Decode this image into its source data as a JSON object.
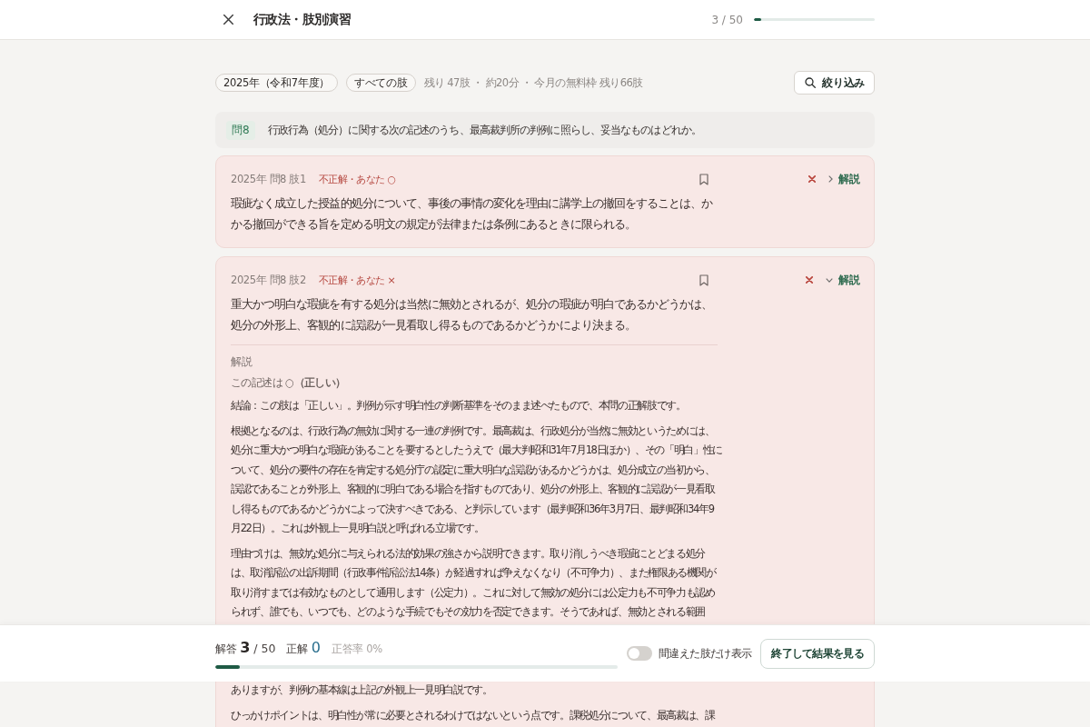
{
  "header": {
    "title": "行政法・肢別演習",
    "progress_text": "3 / 50",
    "level": 0.06
  },
  "filters": {
    "chips": [
      {
        "label": "2025年（令和7年度）"
      },
      {
        "label": "すべての肢"
      }
    ],
    "summary": "残り 47肢 ・ 約20分 ・ 今月の無料枠 残り66肢",
    "button": "絞り込み"
  },
  "question": {
    "number": "問8",
    "text": "行政行為（処分）に関する次の記述のうち、最高裁判所の判例に照らし、妥当なものはどれか。"
  },
  "choices": [
    {
      "meta": "2025年 問8 肢1",
      "status": "不正解・あなた ○",
      "statement": "瑕疵なく成立した授益的処分について、事後の事情の変化を理由に講学上の撤回をすることは、かかる撤回ができる旨を定める明文の規定が法律または条例にあるときに限られる。",
      "bookmarked": false,
      "correct": false,
      "toggle_label": "解説",
      "expanded": false
    },
    {
      "meta": "2025年 問8 肢2",
      "status": "不正解・あなた ×",
      "statement": "重大かつ明白な瑕疵を有する処分は当然に無効とされるが、処分の瑕疵が明白であるかどうかは、処分の外形上、客観的に誤認が一見看取し得るものであるかどうかにより決まる。",
      "bookmarked": false,
      "correct": false,
      "toggle_label": "解説",
      "expanded": true,
      "explanation": {
        "heading": "解説",
        "verdict": "この記述は ○**（正しい）**",
        "paragraphs": [
          "結論：この肢は「正しい」。判例が示す明白性の判断基準をそのまま述べたもので、本問の正解肢です。",
          "根拠となるのは、行政行為の無効に関する一連の判例です。最高裁は、行政処分が当然に無効というためには、処分に重大かつ明白な瑕疵があることを要するとしたうえで（最大判昭和31年7月18日ほか）、その「明白」性について、処分の要件の存在を肯定する処分庁の認定に重大明白な誤認があるかどうかは、処分成立の当初から、誤認であることが外形上、客観的に明白である場合を指すものであり、処分の外形上、客観的に誤認が一見看取し得るものであるかどうかによって決すべきである、と判示しています（最判昭和36年3月7日、最判昭和34年9月22日）。これは外観上一見明白説と呼ばれる立場です。",
          "理由づけは、無効な処分に与えられる法的効果の強さから説明できます。取り消しうべき瑕疵にとどまる処分は、取消訴訟の出訴期間（行政事件訴訟法14条）が経過すれば争えなくなり（不可争力）、また権限ある機関が取り消すまでは有効なものとして通用します（公定力）。これに対して無効の処分には公定力も不可争力も認められず、誰でも、いつでも、どのような手続でもその効力を否定できます。そうであれば、無効とされる範囲"
        ],
        "continued": [
          "ありますが、判例の基本線は上記の外観上一見明白説です。",
          "ひっかけポイントは、明白性が常に必要とされるわけではないという点です。課税処分について、最高裁は、課"
        ]
      }
    }
  ],
  "footer": {
    "answered_label": "解答",
    "answered": "3",
    "total": "/ 50",
    "correct_label": "正解",
    "correct": "0",
    "rate": "正答率 0%",
    "level": 0.06,
    "toggle": {
      "label": "間違えた肢だけ表示",
      "on": false
    },
    "button": "終了して結果を見る"
  }
}
